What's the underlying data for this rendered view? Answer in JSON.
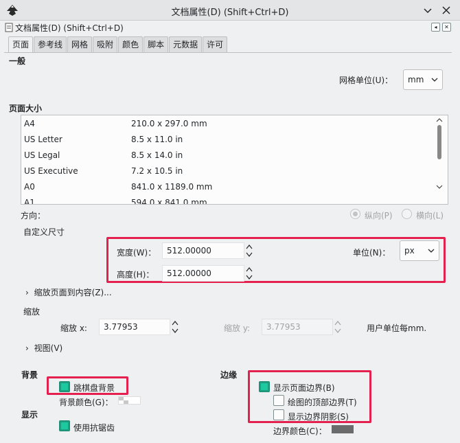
{
  "window": {
    "title": "文档属性(D) (Shift+Ctrl+D)",
    "dock_title": "文档属性(D) (Shift+Ctrl+D)",
    "min_glyph": "⌄",
    "close_glyph": "✕"
  },
  "tabs": [
    "页面",
    "参考线",
    "网格",
    "吸附",
    "颜色",
    "脚本",
    "元数据",
    "许可"
  ],
  "general": {
    "heading": "一般",
    "grid_unit_label": "网格单位(U)：",
    "grid_unit_value": "mm"
  },
  "page_size": {
    "heading": "页面大小",
    "rows": [
      {
        "name": "A4",
        "size": "210.0 x 297.0 mm"
      },
      {
        "name": "US Letter",
        "size": "8.5 x 11.0 in"
      },
      {
        "name": "US Legal",
        "size": "8.5 x 14.0 in"
      },
      {
        "name": "US Executive",
        "size": "7.2 x 10.5 in"
      },
      {
        "name": "A0",
        "size": "841.0 x 1189.0 mm"
      },
      {
        "name": "A1",
        "size": "594.0 x 841.0 mm"
      }
    ]
  },
  "orientation": {
    "label": "方向：",
    "portrait": "纵向(P)",
    "landscape": "横向(L)"
  },
  "custom_size": {
    "heading": "自定义尺寸",
    "width_label": "宽度(W)：",
    "width_value": "512.00000",
    "height_label": "高度(H)：",
    "height_value": "512.00000",
    "unit_label": "单位(N)：",
    "unit_value": "px",
    "resize_expander": "缩放页面到内容(Z)..."
  },
  "scale": {
    "heading": "缩放",
    "scale_x_label": "缩放 x:",
    "scale_x_value": "3.77953",
    "scale_y_label": "缩放 y:",
    "scale_y_value": "3.77953",
    "user_units_label": "用户单位每mm.",
    "viewbox_expander": "视图(V)"
  },
  "background": {
    "heading": "背景",
    "checkerboard_label": "跳棋盘背景",
    "checkerboard_checked": true,
    "bg_color_label": "背景颜色(G)："
  },
  "display": {
    "heading": "显示",
    "antialias_label": "使用抗锯齿",
    "antialias_checked": true
  },
  "border": {
    "heading": "边缘",
    "show_border_label": "显示页面边界(B)",
    "show_border_checked": true,
    "border_on_top_label": "绘图的顶部边界(T)",
    "border_on_top_checked": false,
    "shadow_label": "显示边界阴影(S)",
    "shadow_checked": false,
    "border_color_label": "边界颜色(C)：",
    "border_color": "#6b6b6b"
  },
  "colors": {
    "accent_check": "#1ec9a0",
    "highlight_box": "#e4204f"
  }
}
